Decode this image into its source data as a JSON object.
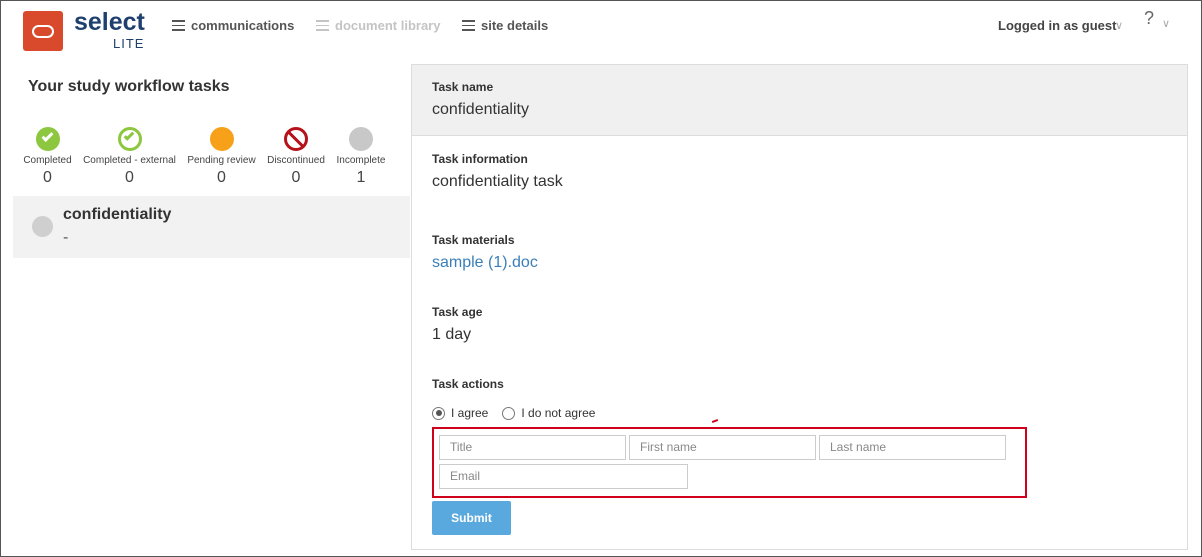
{
  "header": {
    "brand": "select",
    "brand_sub": "LITE",
    "nav": {
      "communications": "communications",
      "document_library": "document library",
      "site_details": "site details"
    },
    "user": "Logged in as guest",
    "help": "?"
  },
  "sidebar": {
    "title": "Your study workflow tasks",
    "statuses": [
      {
        "label": "Completed",
        "count": "0"
      },
      {
        "label": "Completed - external",
        "count": "0"
      },
      {
        "label": "Pending review",
        "count": "0"
      },
      {
        "label": "Discontinued",
        "count": "0"
      },
      {
        "label": "Incomplete",
        "count": "1"
      }
    ],
    "task": {
      "name": "confidentiality",
      "sub": "-"
    }
  },
  "detail": {
    "task_name_label": "Task name",
    "task_name": "confidentiality",
    "task_info_label": "Task information",
    "task_info": "confidentiality task",
    "task_materials_label": "Task materials",
    "task_material_link": "sample (1).doc",
    "task_age_label": "Task age",
    "task_age": "1 day",
    "task_actions_label": "Task actions",
    "radio_agree": "I agree",
    "radio_disagree": "I do not agree",
    "inputs": {
      "title_placeholder": "Title",
      "first_name_placeholder": "First name",
      "last_name_placeholder": "Last name",
      "email_placeholder": "Email"
    },
    "submit_label": "Submit"
  },
  "colors": {
    "accent": "#5aa9de",
    "brand": "#1f3f6e",
    "logo": "#d94a2d",
    "highlight": "#d0021b"
  }
}
